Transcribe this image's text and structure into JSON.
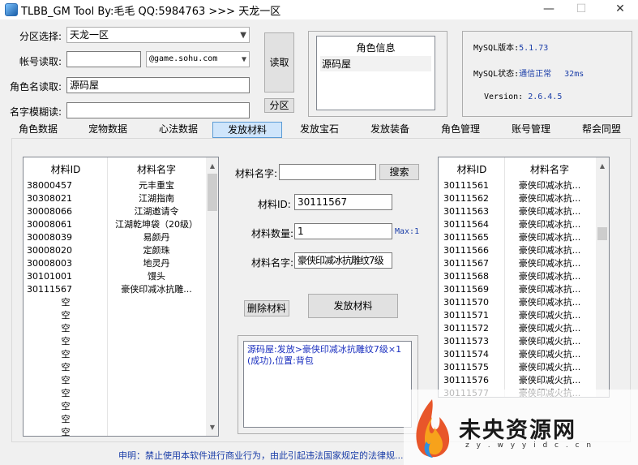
{
  "window": {
    "title": "TLBB_GM Tool By:毛毛 QQ:5984763 >>> 天龙一区",
    "minimize": "—",
    "maximize": "☐",
    "close": "✕"
  },
  "form": {
    "zone_label": "分区选择:",
    "zone_value": "天龙一区",
    "account_label": "帐号读取:",
    "account_value": "",
    "domain_value": "@game.sohu.com",
    "role_label": "角色名读取:",
    "role_value": "源码屋",
    "fuzzy_label": "名字模糊读:",
    "fuzzy_value": "",
    "read_button": "读取",
    "zone_button": "分区"
  },
  "role_info": {
    "header": "角色信息",
    "items": [
      "源码屋"
    ]
  },
  "mysql": {
    "version_label": "MySQL版本:",
    "version_value": "5.1.73",
    "status_label": "MySQL状态:",
    "status_value": "通信正常",
    "latency": "32ms",
    "version2_label": "Version:",
    "version2_value": "2.6.4.5"
  },
  "tabs": [
    "角色数据",
    "宠物数据",
    "心法数据",
    "发放材料",
    "发放宝石",
    "发放装备",
    "角色管理",
    "账号管理",
    "帮会同盟"
  ],
  "active_tab": "发放材料",
  "left_list": {
    "headers": [
      "材料ID",
      "材料名字"
    ],
    "rows": [
      [
        "38000457",
        "元丰重宝"
      ],
      [
        "30308021",
        "江湖指南"
      ],
      [
        "30008066",
        "江湖邀请令"
      ],
      [
        "30008061",
        "江湖乾坤袋（20级）"
      ],
      [
        "30008039",
        "易颜丹"
      ],
      [
        "30008020",
        "定颜珠"
      ],
      [
        "30008003",
        "地灵丹"
      ],
      [
        "30101001",
        "馒头"
      ],
      [
        "30111567",
        "豪侠印减冰抗雕..."
      ],
      [
        "空",
        ""
      ],
      [
        "空",
        ""
      ],
      [
        "空",
        ""
      ],
      [
        "空",
        ""
      ],
      [
        "空",
        ""
      ],
      [
        "空",
        ""
      ],
      [
        "空",
        ""
      ],
      [
        "空",
        ""
      ],
      [
        "空",
        ""
      ],
      [
        "空",
        ""
      ],
      [
        "空",
        ""
      ]
    ]
  },
  "center": {
    "material_name_label": "材料名字:",
    "material_name_value": "",
    "search_button": "搜索",
    "material_id_label": "材料ID:",
    "material_id_value": "30111567",
    "quantity_label": "材料数量:",
    "quantity_value": "1",
    "max_label": "Max:1",
    "material_name2_label": "材料名字:",
    "material_name2_value": "豪侠印减冰抗雕纹7级",
    "delete_button": "删除材料",
    "issue_button": "发放材料",
    "log_text": "源码屋:发放>豪侠印减冰抗雕纹7级×1(成功),位置:背包"
  },
  "right_list": {
    "headers": [
      "材料ID",
      "材料名字"
    ],
    "rows": [
      [
        "30111561",
        "豪侠印减冰抗..."
      ],
      [
        "30111562",
        "豪侠印减冰抗..."
      ],
      [
        "30111563",
        "豪侠印减冰抗..."
      ],
      [
        "30111564",
        "豪侠印减冰抗..."
      ],
      [
        "30111565",
        "豪侠印减冰抗..."
      ],
      [
        "30111566",
        "豪侠印减冰抗..."
      ],
      [
        "30111567",
        "豪侠印减冰抗..."
      ],
      [
        "30111568",
        "豪侠印减冰抗..."
      ],
      [
        "30111569",
        "豪侠印减冰抗..."
      ],
      [
        "30111570",
        "豪侠印减冰抗..."
      ],
      [
        "30111571",
        "豪侠印减火抗..."
      ],
      [
        "30111572",
        "豪侠印减火抗..."
      ],
      [
        "30111573",
        "豪侠印减火抗..."
      ],
      [
        "30111574",
        "豪侠印减火抗..."
      ],
      [
        "30111575",
        "豪侠印减火抗..."
      ],
      [
        "30111576",
        "豪侠印减火抗..."
      ],
      [
        "30111577",
        "豪侠印减火抗..."
      ]
    ]
  },
  "footer": {
    "notice": "申明：禁止使用本软件进行商业行为，由此引起违法国家规定的法律规..."
  },
  "watermark": {
    "text": "未央资源网",
    "sub": "z y . w y y i d c . c n"
  },
  "icons": {
    "scroll_up": "▲",
    "scroll_down": "▼",
    "dropdown": "▼"
  },
  "colors": {
    "accent": "#5b9bd5",
    "mysql_blue": "#1b3ea8",
    "log_blue": "#1a2fbf"
  }
}
